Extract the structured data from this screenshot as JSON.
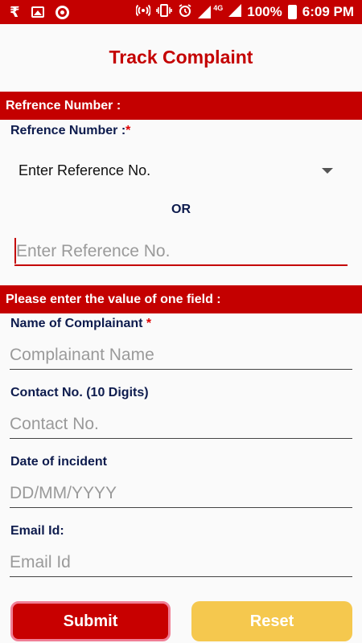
{
  "status_bar": {
    "icons_left": [
      "rupee-icon",
      "image-icon",
      "circle-icon"
    ],
    "icons_right": [
      "hotspot-icon",
      "vibrate-icon",
      "alarm-icon",
      "signal-icon",
      "battery-icon"
    ],
    "network_tag": "4G",
    "battery_percent": "100%",
    "time": "6:09 PM",
    "rupee_glyph": "₹"
  },
  "page": {
    "title": "Track Complaint"
  },
  "reference_section": {
    "header": "Refrence Number :",
    "label": "Refrence Number :",
    "required_mark": "*",
    "dropdown_value": "Enter Reference No.",
    "or_text": "OR",
    "input_placeholder": "Enter Reference No.",
    "input_value": ""
  },
  "detail_section": {
    "header": "Please enter the value of one field :",
    "fields": [
      {
        "label": "Name of Complainant ",
        "required_mark": "*",
        "placeholder": "Complainant Name",
        "value": ""
      },
      {
        "label": "Contact No. (10 Digits)",
        "placeholder": "Contact No.",
        "value": ""
      },
      {
        "label": "Date of incident",
        "placeholder": "DD/MM/YYYY",
        "value": ""
      },
      {
        "label": "Email Id:",
        "placeholder": "Email Id",
        "value": ""
      }
    ]
  },
  "buttons": {
    "submit": "Submit",
    "reset": "Reset"
  },
  "colors": {
    "primary_red": "#c40000",
    "label_navy": "#0d1b4d",
    "reset_yellow": "#f5c84e"
  }
}
